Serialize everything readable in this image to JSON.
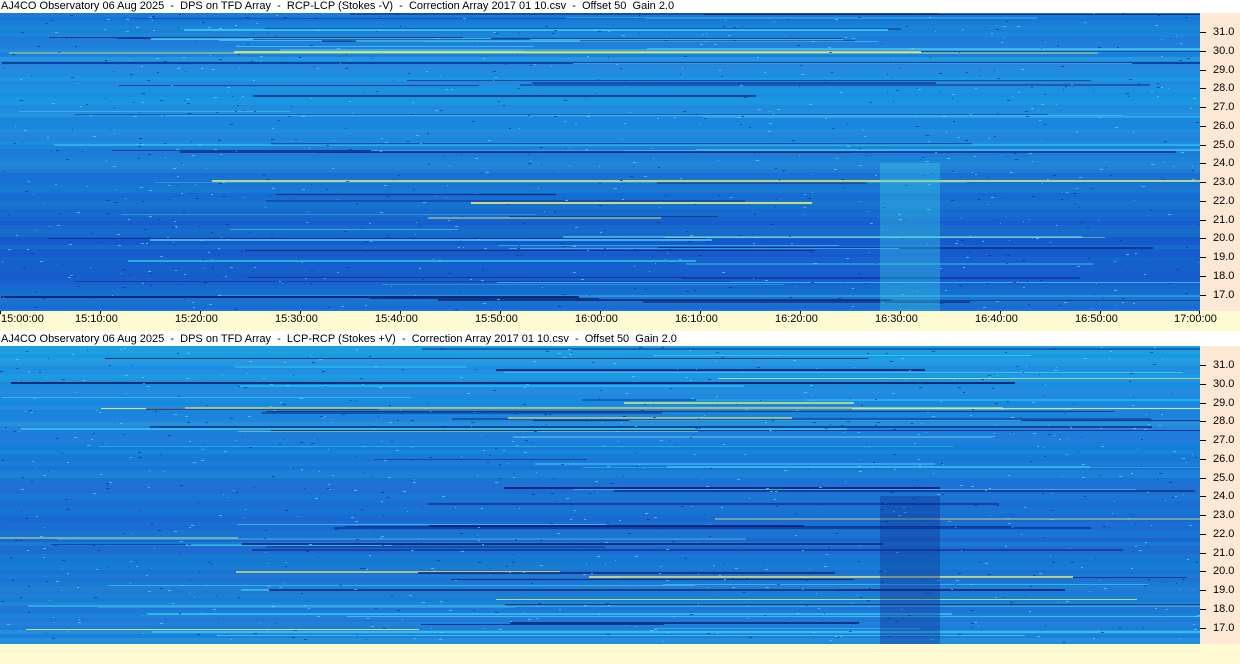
{
  "panels": [
    {
      "title": "AJ4CO Observatory 06 Aug 2025  -  DPS on TFD Array  -  RCP-LCP (Stokes -V)  -  Correction Array 2017 01 10.csv  -  Offset 50  Gain 2.0"
    },
    {
      "title": "AJ4CO Observatory 06 Aug 2025  -  DPS on TFD Array  -  LCP-RCP (Stokes +V)  -  Correction Array 2017 01 10.csv  -  Offset 50  Gain 2.0"
    }
  ],
  "freq_ticks": [
    "31.0",
    "30.0",
    "29.0",
    "28.0",
    "27.0",
    "26.0",
    "25.0",
    "24.0",
    "23.0",
    "22.0",
    "21.0",
    "20.0",
    "19.0",
    "18.0",
    "17.0"
  ],
  "time_ticks": [
    "15:00:00",
    "15:10:00",
    "15:20:00",
    "15:30:00",
    "15:40:00",
    "15:50:00",
    "16:00:00",
    "16:10:00",
    "16:20:00",
    "16:30:00",
    "16:40:00",
    "16:50:00",
    "17:00:00"
  ],
  "colors": {
    "spectrogram_base": "#1a5be0",
    "axis_bg": "#fde8d6",
    "time_axis_bg": "#fefbd3"
  }
}
